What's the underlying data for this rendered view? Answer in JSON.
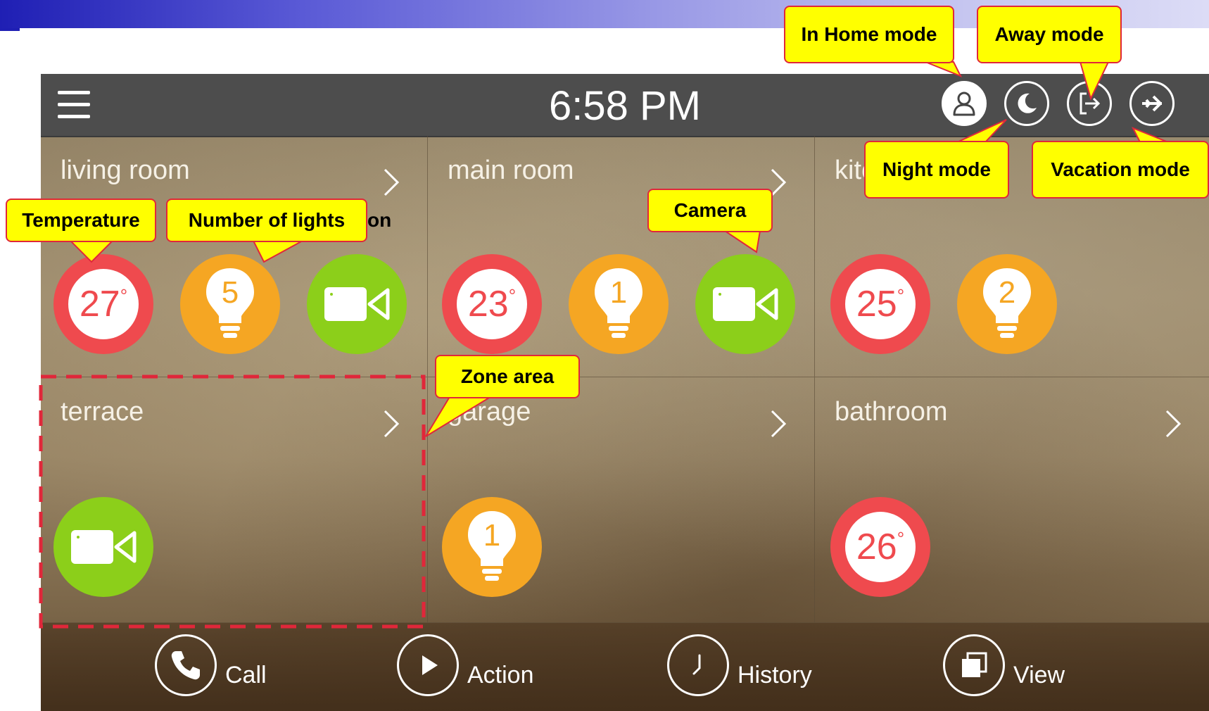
{
  "top_bar": {
    "clock": "6:58 PM"
  },
  "modes": [
    {
      "name": "In Home mode",
      "icon": "person-icon",
      "active": true
    },
    {
      "name": "Night mode",
      "icon": "moon-icon",
      "active": false
    },
    {
      "name": "Away mode",
      "icon": "exit-door-icon",
      "active": false
    },
    {
      "name": "Vacation mode",
      "icon": "airplane-icon",
      "active": false
    }
  ],
  "zones": [
    {
      "name": "living room",
      "temperature": "27",
      "lights": "5",
      "camera": true
    },
    {
      "name": "main room",
      "temperature": "23",
      "lights": "1",
      "camera": true
    },
    {
      "name": "kitchen",
      "temperature": "25",
      "lights": "2",
      "camera": false
    },
    {
      "name": "terrace",
      "camera": true
    },
    {
      "name": "garage",
      "lights": "1"
    },
    {
      "name": "bathroom",
      "temperature": "26"
    }
  ],
  "degree_symbol": "°",
  "bottom_bar": {
    "call": "Call",
    "action": "Action",
    "history": "History",
    "view": "View"
  },
  "annotations": {
    "in_home_mode": "In Home mode",
    "away_mode": "Away mode",
    "night_mode": "Night mode",
    "vacation_mode": "Vacation mode",
    "temperature": "Temperature",
    "number_of_lights": "Number of lights",
    "lights_suffix": "on",
    "camera": "Camera",
    "zone_area": "Zone area"
  },
  "colors": {
    "temperature": "#ef4a4e",
    "light": "#f5a623",
    "camera": "#8ccf1a",
    "callout_fill": "#ffff00",
    "callout_border": "#e0273a"
  }
}
